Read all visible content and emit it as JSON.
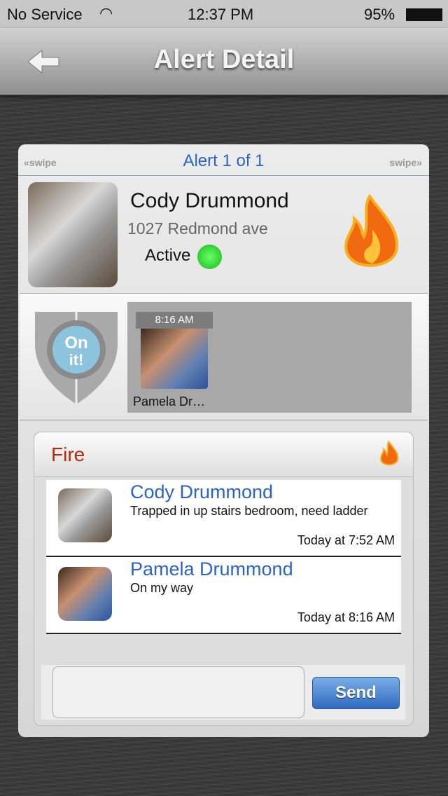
{
  "status_bar": {
    "carrier": "No Service",
    "time": "12:37 PM",
    "battery": "95%"
  },
  "nav": {
    "title": "Alert Detail",
    "back_icon": "back-arrow-icon"
  },
  "alert": {
    "swipe_left": "swipe",
    "swipe_right": "swipe",
    "counter": "Alert 1 of 1",
    "name": "Cody Drummond",
    "address": "1027 Redmond ave",
    "status": "Active",
    "status_color": "#44dd33",
    "type_icon": "fire-icon"
  },
  "on_it": {
    "label_line1": "On",
    "label_line2": "it!",
    "responders": [
      {
        "time": "8:16 AM",
        "name": "Pamela Dr…"
      }
    ]
  },
  "panel": {
    "title": "Fire",
    "messages": [
      {
        "name": "Cody Drummond",
        "text": "Trapped in up stairs bedroom, need ladder",
        "time": "Today at 7:52 AM"
      },
      {
        "name": "Pamela Drummond",
        "text": "On my way",
        "time": "Today at 8:16 AM"
      }
    ],
    "input_value": "",
    "send_label": "Send"
  }
}
